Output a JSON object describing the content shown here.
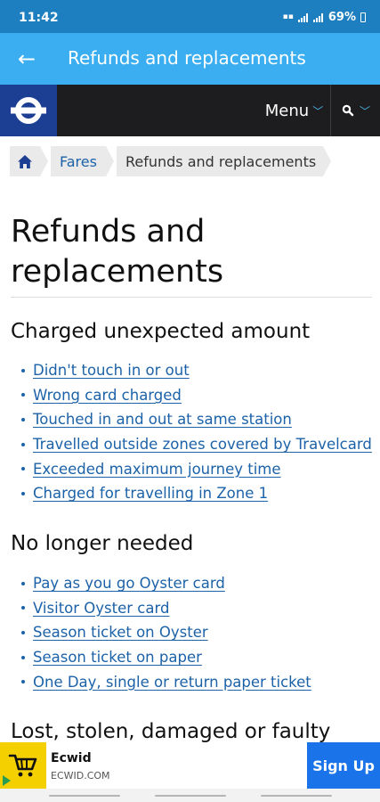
{
  "status": {
    "time": "11:42",
    "battery": "69%"
  },
  "app_bar": {
    "title": "Refunds and replacements",
    "back_icon": "arrow-left-icon"
  },
  "header": {
    "menu_label": "Menu",
    "search_icon": "search-icon",
    "colors": {
      "bar": "#1d1d1f",
      "logo_bg": "#1c3f94"
    }
  },
  "breadcrumb": {
    "items": [
      "Fares",
      "Refunds and replacements"
    ],
    "home_icon": "home-icon"
  },
  "page": {
    "title": "Refunds and replacements",
    "sections": [
      {
        "heading": "Charged unexpected amount",
        "links": [
          "Didn't touch in or out",
          "Wrong card charged",
          "Touched in and out at same station",
          "Travelled outside zones covered by Travelcard",
          "Exceeded maximum journey time",
          "Charged for travelling in Zone 1"
        ]
      },
      {
        "heading": "No longer needed",
        "links": [
          "Pay as you go Oyster card",
          "Visitor Oyster card",
          "Season ticket on Oyster",
          "Season ticket on paper",
          "One Day, single or return paper ticket"
        ]
      },
      {
        "heading": "Lost, stolen, damaged or faulty",
        "links": []
      }
    ]
  },
  "ad": {
    "name": "Ecwid",
    "domain": "ECWID.COM",
    "cta": "Sign Up",
    "icon": "cart-icon"
  },
  "colors": {
    "app_bar": "#3aaef0",
    "status_bar": "#1e7fc0",
    "link": "#1c62a8",
    "cta": "#1a73e8"
  }
}
